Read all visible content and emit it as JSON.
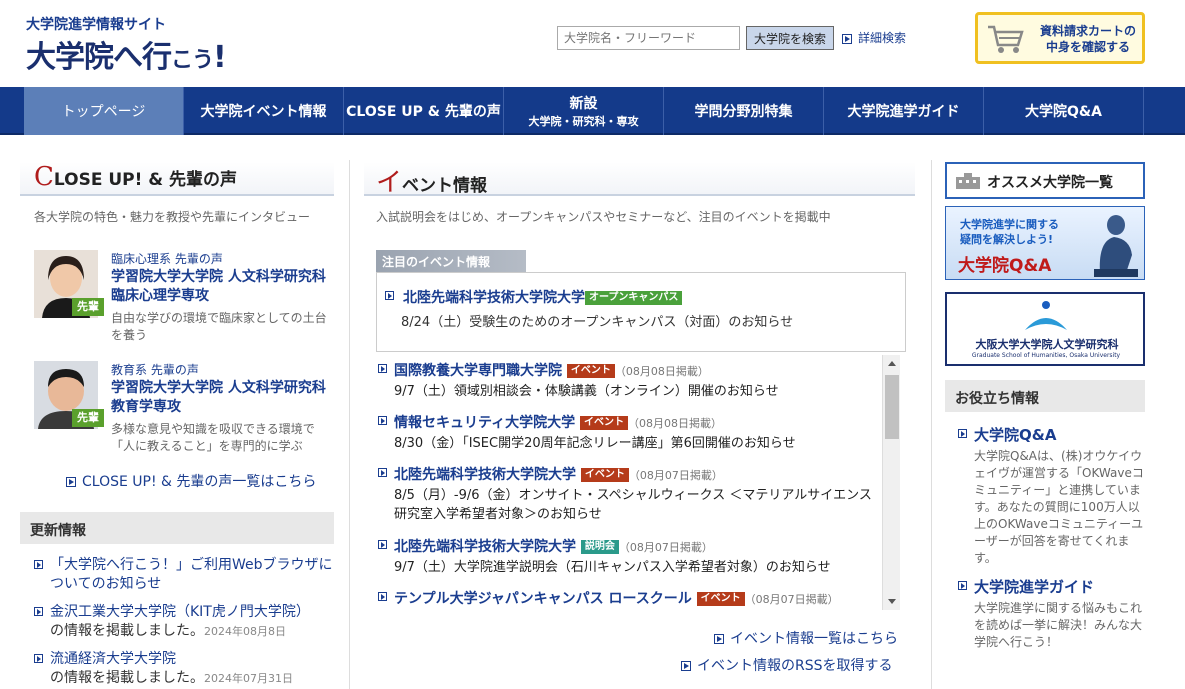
{
  "header": {
    "logo_sub": "大学院進学情報サイト",
    "logo_main": "大学院へ行",
    "logo_small": "こう",
    "logo_excl": "!",
    "search_placeholder": "大学院名・フリーワード",
    "search_button": "大学院を検索",
    "advanced_search": "詳細検索",
    "cart_line1": "資料請求カートの",
    "cart_line2": "中身を確認する"
  },
  "nav": {
    "items": [
      {
        "label": "トップページ"
      },
      {
        "label": "大学院イベント情報"
      },
      {
        "label": "CLOSE UP & 先輩の声"
      },
      {
        "label": "新設",
        "sub": "大学院・研究科・専攻"
      },
      {
        "label": "学問分野別特集"
      },
      {
        "label": "大学院進学ガイド"
      },
      {
        "label": "大学院Q&A"
      }
    ]
  },
  "closeup": {
    "head_big": "C",
    "head_rest": "LOSE UP! & 先輩の声",
    "lead": "各大学院の特色・魅力を教授や先輩にインタビュー",
    "badge": "先輩",
    "voices": [
      {
        "cat": "臨床心理系 先輩の声",
        "title": "学習院大学大学院 人文科学研究科　臨床心理学専攻",
        "desc": "自由な学びの環境で臨床家としての土台を養う"
      },
      {
        "cat": "教育系 先輩の声",
        "title": "学習院大学大学院 人文科学研究科 教育学専攻",
        "desc": "多様な意見や知識を吸収できる環境で「人に教えること」を専門的に学ぶ"
      }
    ],
    "more_link": "CLOSE UP! & 先輩の声一覧はこちら"
  },
  "updates": {
    "head": "更新情報",
    "items": [
      {
        "link": "「大学院へ行こう！」ご利用Webブラウザについてのお知らせ",
        "suffix": "",
        "date": ""
      },
      {
        "link": "金沢工業大学大学院（KIT虎ノ門大学院）",
        "suffix": "の情報を掲載しました。",
        "date": "2024年08月8日"
      },
      {
        "link": "流通経済大学大学院",
        "suffix": "の情報を掲載しました。",
        "date": "2024年07月31日"
      }
    ]
  },
  "events": {
    "head_big": "イ",
    "head_rest": "ベント情報",
    "lead": "入試説明会をはじめ、オープンキャンパスやセミナーなど、注目のイベントを掲載中",
    "featured_tab": "注目のイベント情報",
    "featured": {
      "uni": "北陸先端科学技術大学院大学",
      "tag": "オープンキャンパス",
      "text": "8/24（土）受験生のためのオープンキャンパス（対面）のお知らせ"
    },
    "list": [
      {
        "uni": "国際教養大学専門職大学院",
        "tag": "イベント",
        "tag_type": "event",
        "posted": "（08月08日掲載）",
        "text": "9/7（土）領域別相談会・体験講義（オンライン）開催のお知らせ"
      },
      {
        "uni": "情報セキュリティ大学院大学",
        "tag": "イベント",
        "tag_type": "event",
        "posted": "（08月08日掲載）",
        "text": "8/30（金）「ISEC開学20周年記念リレー講座」第6回開催のお知らせ"
      },
      {
        "uni": "北陸先端科学技術大学院大学",
        "tag": "イベント",
        "tag_type": "event",
        "posted": "（08月07日掲載）",
        "text": "8/5（月）-9/6（金）オンサイト・スペシャルウィークス ＜マテリアルサイエンス研究室入学希望者対象＞のお知らせ"
      },
      {
        "uni": "北陸先端科学技術大学院大学",
        "tag": "説明会",
        "tag_type": "setsu",
        "posted": "（08月07日掲載）",
        "text": "9/7（土）大学院進学説明会（石川キャンパス入学希望者対象）のお知らせ"
      },
      {
        "uni": "テンプル大学ジャパンキャンパス ロースクール",
        "tag": "イベント",
        "tag_type": "event",
        "posted": "（08月07日掲載）",
        "text": ""
      }
    ],
    "more_link": "イベント情報一覧はこちら",
    "rss_link": "イベント情報のRSSを取得する"
  },
  "right": {
    "recommend_btn": "オススメ大学院一覧",
    "qa_banner_line1": "大学院進学に関する",
    "qa_banner_line2": "疑問を解決しよう!",
    "qa_banner_title": "大学院Q&A",
    "osaka_title": "大阪大学大学院人文学研究科",
    "osaka_sub": "Graduate School of Humanities, Osaka University",
    "util_head": "お役立ち情報",
    "util": [
      {
        "title": "大学院Q&A",
        "desc": "大学院Q&Aは、(株)オウケイウェイヴが運営する「OKWaveコミュニティー」と連携しています。あなたの質問に100万人以上のOKWaveコミュニティーユーザーが回答を寄せてくれます。"
      },
      {
        "title": "大学院進学ガイド",
        "desc": "大学院進学に関する悩みもこれを読めば一挙に解決！みんな大学院へ行こう！"
      }
    ]
  },
  "colors": {
    "nav": "#143a8a",
    "nav_active": "#5c7fb8",
    "link": "#1a3d8f",
    "accent_red": "#b01c1c"
  }
}
